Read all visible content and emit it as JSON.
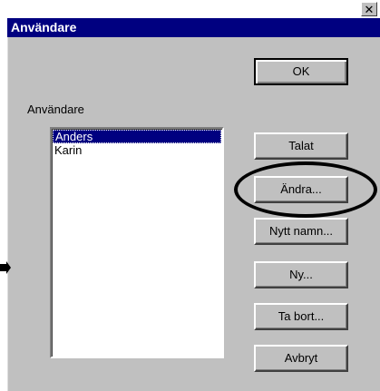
{
  "window": {
    "title": "Användare",
    "close_glyph": "✕"
  },
  "list_label": "Användare",
  "users": [
    "Anders",
    "Karin"
  ],
  "selected_user": "Anders",
  "buttons": {
    "ok": "OK",
    "talat": "Talat",
    "andra": "Ändra...",
    "nytt_namn": "Nytt namn...",
    "ny": "Ny...",
    "ta_bort": "Ta bort...",
    "avbryt": "Avbryt"
  },
  "icons": {
    "arrow": "pointer-arrow-icon",
    "close": "close-icon"
  }
}
